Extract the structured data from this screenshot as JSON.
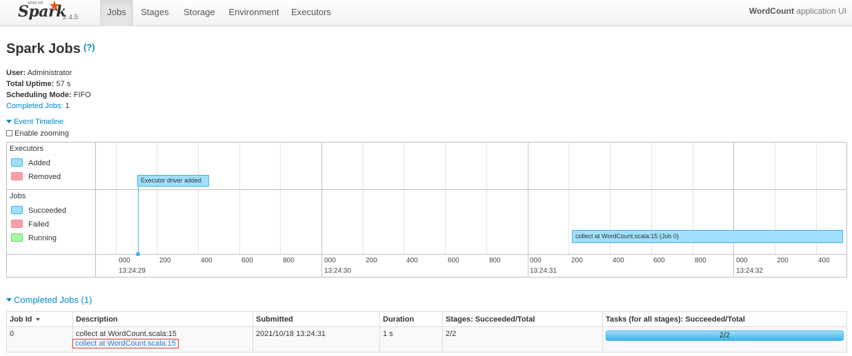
{
  "navbar": {
    "brand": {
      "apache": "APACHE",
      "name": "Spark",
      "version": "2.4.5"
    },
    "tabs": [
      {
        "label": "Jobs",
        "active": true
      },
      {
        "label": "Stages",
        "active": false
      },
      {
        "label": "Storage",
        "active": false
      },
      {
        "label": "Environment",
        "active": false
      },
      {
        "label": "Executors",
        "active": false
      }
    ],
    "app_name": "WordCount",
    "app_suffix": "application UI"
  },
  "page": {
    "title": "Spark Jobs",
    "help": "(?)"
  },
  "summary": {
    "user_label": "User:",
    "user": "Administrator",
    "uptime_label": "Total Uptime:",
    "uptime": "57 s",
    "mode_label": "Scheduling Mode:",
    "mode": "FIFO",
    "completed_label": "Completed Jobs:",
    "completed": "1"
  },
  "timeline": {
    "toggle_label": "Event Timeline",
    "zoom_label": "Enable zooming",
    "executors": {
      "title": "Executors",
      "legend": [
        "Added",
        "Removed"
      ],
      "event": "Executor driver added"
    },
    "jobs": {
      "title": "Jobs",
      "legend": [
        "Succeeded",
        "Failed",
        "Running"
      ],
      "event": "collect at WordCount.scala:15 (Job 0)"
    },
    "minor_ticks": [
      "000",
      "200",
      "400",
      "600",
      "800",
      "000",
      "200",
      "400",
      "600",
      "800",
      "000",
      "200",
      "400",
      "600",
      "800",
      "000",
      "200",
      "400"
    ],
    "major_ticks": [
      "13:24:29",
      "13:24:30",
      "13:24:31",
      "13:24:32"
    ],
    "colors": {
      "added": "#a0dfff",
      "removed": "#ff9fae",
      "running": "#a0ffa0",
      "accent": "#3eb3e6"
    }
  },
  "completed_jobs": {
    "heading": "Completed Jobs (1)",
    "columns": [
      "Job Id",
      "Description",
      "Submitted",
      "Duration",
      "Stages: Succeeded/Total",
      "Tasks (for all stages): Succeeded/Total"
    ],
    "rows": [
      {
        "job_id": "0",
        "description": "collect at WordCount.scala:15",
        "description_link": "collect at WordCount.scala:15",
        "submitted": "2021/10/18 13:24:31",
        "duration": "1 s",
        "stages": "2/2",
        "tasks": "2/2",
        "tasks_progress": 1.0
      }
    ]
  }
}
